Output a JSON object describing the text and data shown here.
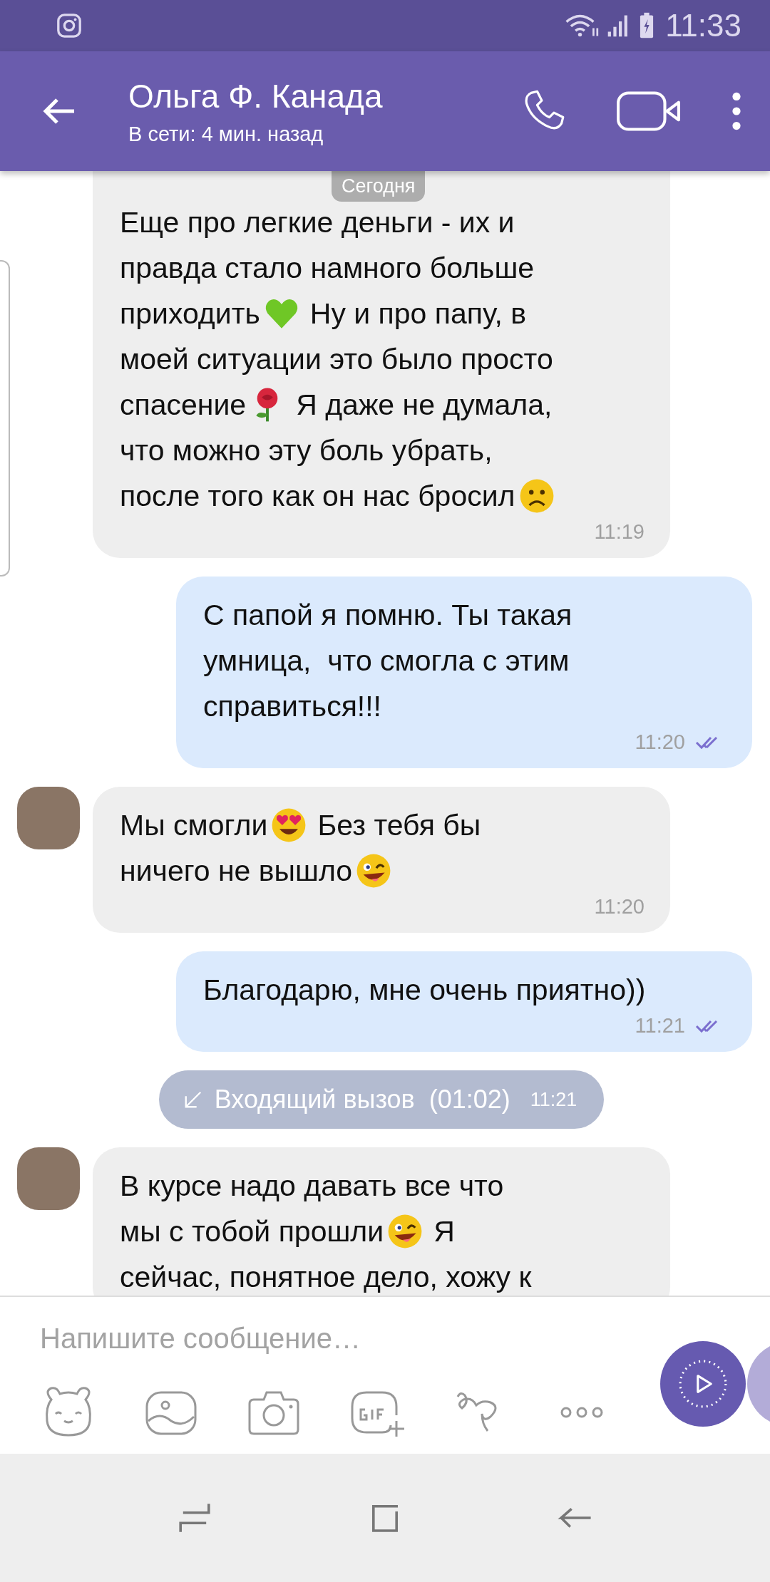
{
  "status_bar": {
    "time": "11:33"
  },
  "header": {
    "title": "Ольга Ф. Канада",
    "subtitle": "В сети: 4 мин. назад"
  },
  "date_pill": "Сегодня",
  "messages": [
    {
      "kind": "incoming",
      "avatar": false,
      "lines": [
        [
          {
            "kind": "text",
            "text": "Еще про легкие деньги - их и"
          }
        ],
        [
          {
            "kind": "text",
            "text": "правда стало намного больше"
          }
        ],
        [
          {
            "kind": "text",
            "text": "приходить"
          },
          {
            "kind": "green-heart"
          },
          {
            "kind": "text",
            "text": "Ну и про папу, в"
          }
        ],
        [
          {
            "kind": "text",
            "text": "моей ситуации это было просто"
          }
        ],
        [
          {
            "kind": "text",
            "text": "спасение"
          },
          {
            "kind": "rose"
          },
          {
            "kind": "text",
            "text": "Я даже не думала,"
          }
        ],
        [
          {
            "kind": "text",
            "text": "что можно эту боль убрать,"
          }
        ],
        [
          {
            "kind": "text",
            "text": "после того как он нас бросил"
          },
          {
            "kind": "frown"
          }
        ]
      ],
      "time": "11:19"
    },
    {
      "kind": "outgoing",
      "read": true,
      "lines": [
        [
          {
            "kind": "text",
            "text": "С папой я помню. Ты такая"
          }
        ],
        [
          {
            "kind": "text",
            "text": "умница,  что смогла с этим"
          }
        ],
        [
          {
            "kind": "text",
            "text": "справиться!!!"
          }
        ]
      ],
      "time": "11:20"
    },
    {
      "kind": "incoming",
      "avatar": true,
      "lines": [
        [
          {
            "kind": "text",
            "text": "Мы смогли"
          },
          {
            "kind": "heart-eyes"
          },
          {
            "kind": "text",
            "text": "Без тебя бы"
          }
        ],
        [
          {
            "kind": "text",
            "text": "ничего не вышло"
          },
          {
            "kind": "wink"
          }
        ]
      ],
      "time": "11:20"
    },
    {
      "kind": "outgoing",
      "read": true,
      "lines": [
        [
          {
            "kind": "text",
            "text": "Благодарю, мне очень приятно))"
          }
        ]
      ],
      "time": "11:21"
    },
    {
      "kind": "call",
      "label": "Входящий вызов  (01:02)",
      "time": "11:21"
    },
    {
      "kind": "incoming",
      "avatar": true,
      "lines": [
        [
          {
            "kind": "text",
            "text": "В курсе надо давать все что"
          }
        ],
        [
          {
            "kind": "text",
            "text": "мы с тобой прошли"
          },
          {
            "kind": "wink"
          },
          {
            "kind": "text",
            "text": "Я"
          }
        ],
        [
          {
            "kind": "text",
            "text": "сейчас, понятное дело, хожу к"
          }
        ]
      ]
    }
  ],
  "composer": {
    "placeholder": "Напишите сообщение…"
  }
}
